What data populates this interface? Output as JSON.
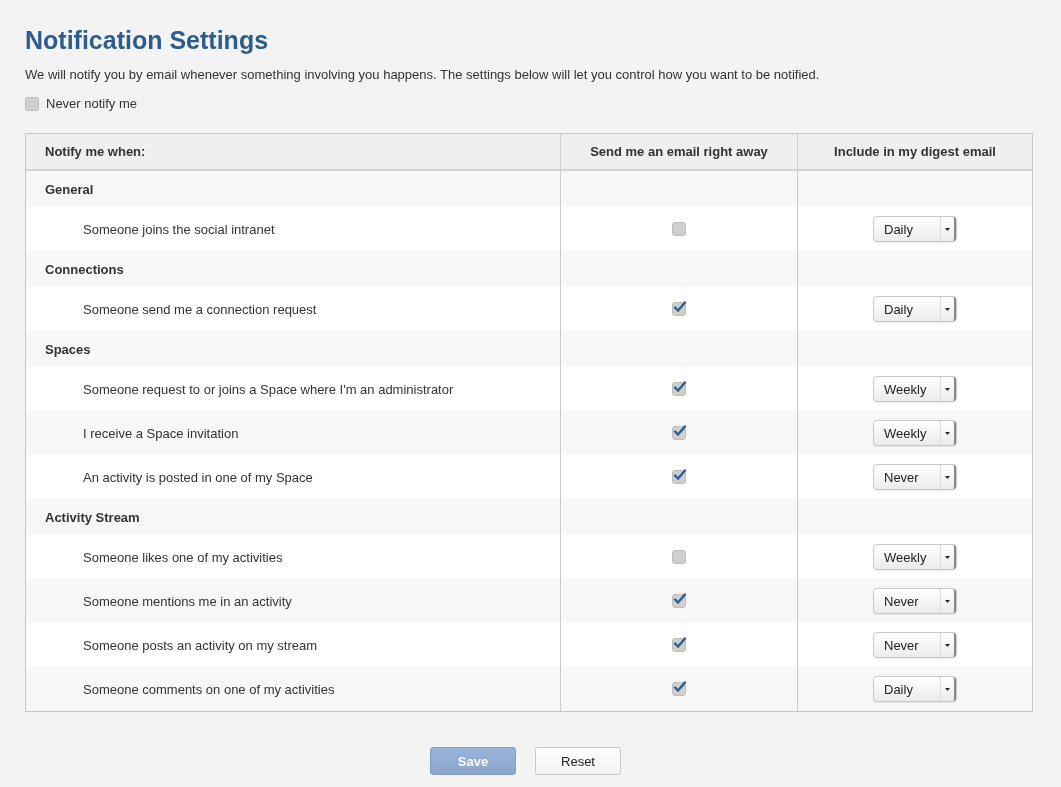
{
  "title": "Notification Settings",
  "description": "We will notify you by email whenever something involving you happens. The settings below will let you control how you want to be notified.",
  "never_notify": {
    "label": "Never notify me",
    "checked": false
  },
  "table": {
    "columns": [
      "Notify me when:",
      "Send me an email right away",
      "Include in my digest email"
    ],
    "groups": [
      {
        "name": "General",
        "rows": [
          {
            "label": "Someone joins the social intranet",
            "email": false,
            "digest": "Daily"
          }
        ]
      },
      {
        "name": "Connections",
        "rows": [
          {
            "label": "Someone send me a connection request",
            "email": true,
            "digest": "Daily"
          }
        ]
      },
      {
        "name": "Spaces",
        "rows": [
          {
            "label": "Someone request to or joins a Space where I'm an administrator",
            "email": true,
            "digest": "Weekly"
          },
          {
            "label": "I receive a Space invitation",
            "email": true,
            "digest": "Weekly"
          },
          {
            "label": "An activity is posted in one of my Space",
            "email": true,
            "digest": "Never"
          }
        ]
      },
      {
        "name": "Activity Stream",
        "rows": [
          {
            "label": "Someone likes one of my activities",
            "email": false,
            "digest": "Weekly"
          },
          {
            "label": "Someone mentions me in an activity",
            "email": true,
            "digest": "Never"
          },
          {
            "label": "Someone posts an activity on my stream",
            "email": true,
            "digest": "Never"
          },
          {
            "label": "Someone comments on one of my activities",
            "email": true,
            "digest": "Daily"
          }
        ]
      }
    ]
  },
  "buttons": [
    {
      "label": "Save",
      "kind": "primary",
      "disabled": true
    },
    {
      "label": "Reset",
      "kind": "default",
      "disabled": false
    }
  ]
}
